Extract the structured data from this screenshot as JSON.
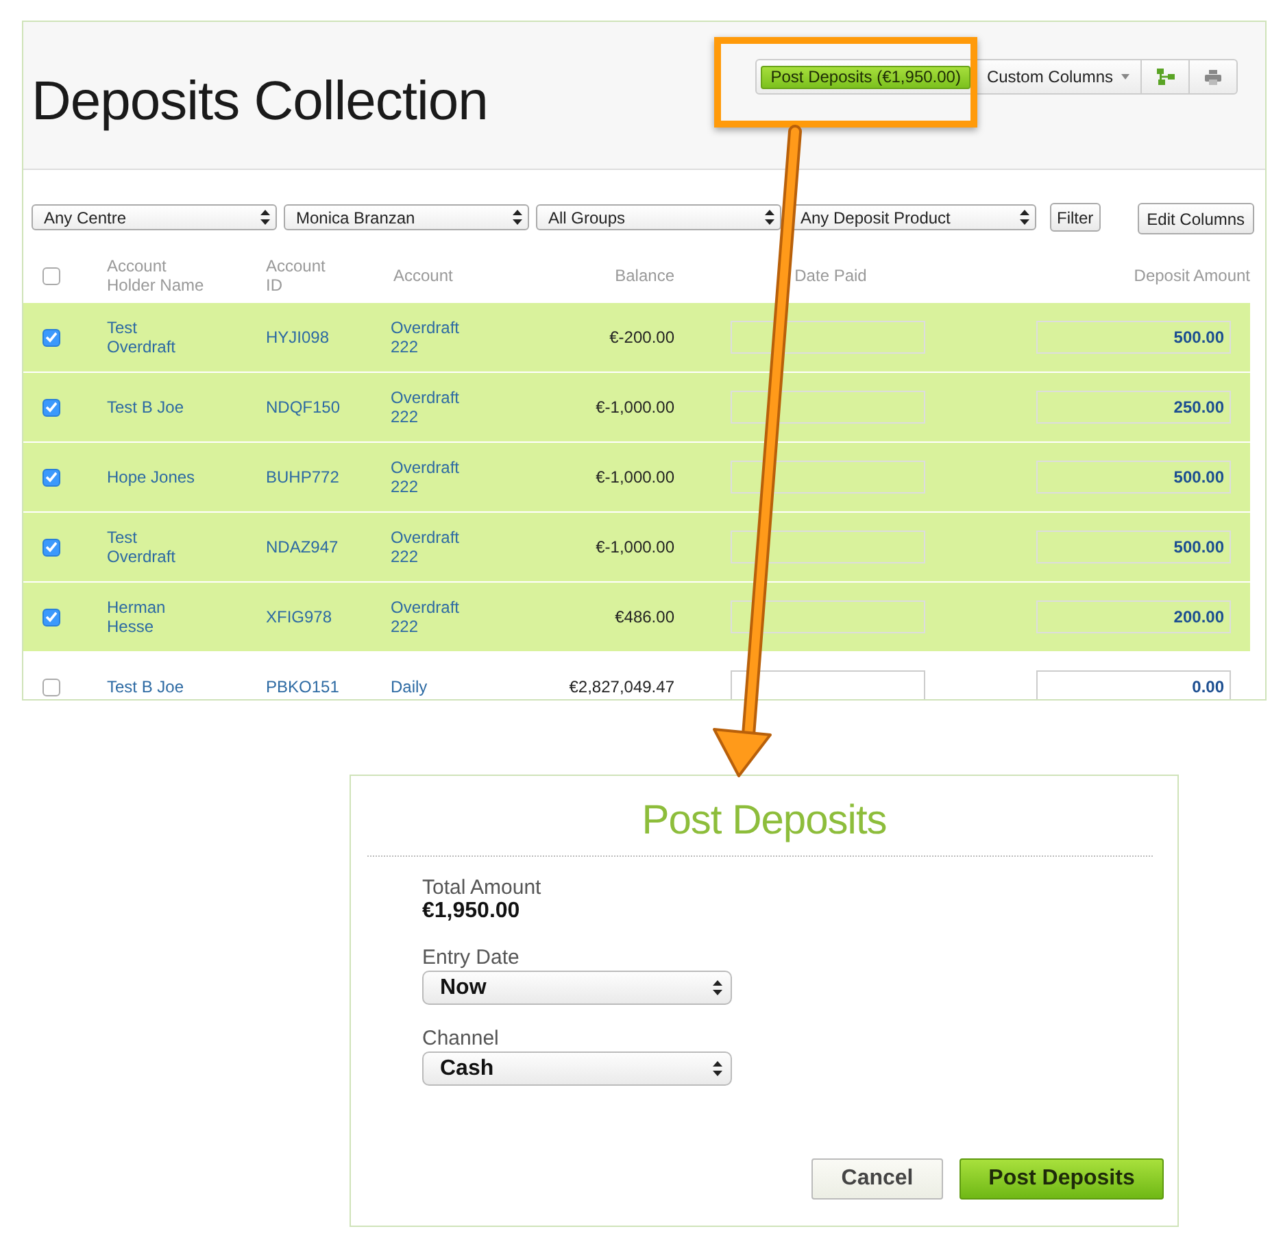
{
  "page": {
    "title": "Deposits Collection"
  },
  "toolbar": {
    "post_button": "Post Deposits (€1,950.00)",
    "custom_columns": "Custom Columns"
  },
  "filters": [
    {
      "value": "Any Centre"
    },
    {
      "value": "Monica Branzan"
    },
    {
      "value": "All Groups"
    },
    {
      "value": "Any Deposit Product"
    }
  ],
  "filter_button": "Filter",
  "edit_columns_button": "Edit Columns",
  "table": {
    "select_all": {
      "checked": false
    },
    "columns": [
      "Account Holder Name",
      "Account ID",
      "Account",
      "Balance",
      "Date Paid",
      "Deposit Amount"
    ],
    "rows": [
      {
        "checked": true,
        "holder": "Test Overdraft",
        "id": "HYJI098",
        "account": "Overdraft 222",
        "balance": "€-200.00",
        "deposit": "500.00"
      },
      {
        "checked": true,
        "holder": "Test B Joe",
        "id": "NDQF150",
        "account": "Overdraft 222",
        "balance": "€-1,000.00",
        "deposit": "250.00"
      },
      {
        "checked": true,
        "holder": "Hope Jones",
        "id": "BUHP772",
        "account": "Overdraft 222",
        "balance": "€-1,000.00",
        "deposit": "500.00"
      },
      {
        "checked": true,
        "holder": "Test Overdraft",
        "id": "NDAZ947",
        "account": "Overdraft 222",
        "balance": "€-1,000.00",
        "deposit": "500.00"
      },
      {
        "checked": true,
        "holder": "Herman Hesse",
        "id": "XFIG978",
        "account": "Overdraft 222",
        "balance": "€486.00",
        "deposit": "200.00"
      },
      {
        "checked": false,
        "holder": "Test B Joe",
        "id": "PBKO151",
        "account": "Daily",
        "balance": "€2,827,049.47",
        "deposit": "0.00"
      }
    ]
  },
  "dialog": {
    "title": "Post Deposits",
    "total_label": "Total Amount",
    "total_value": "€1,950.00",
    "fields": [
      {
        "label": "Entry Date",
        "value": "Now"
      },
      {
        "label": "Channel",
        "value": "Cash"
      }
    ],
    "buttons": [
      {
        "label": "Cancel",
        "kind": "secondary"
      },
      {
        "label": "Post Deposits",
        "kind": "primary"
      }
    ]
  }
}
